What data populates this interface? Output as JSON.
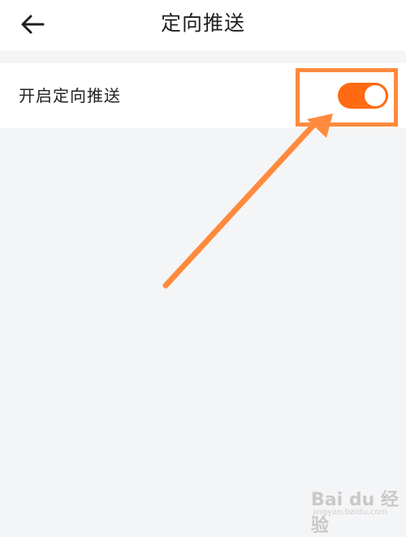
{
  "header": {
    "title": "定向推送",
    "back_icon": "arrow-left-icon"
  },
  "settings": [
    {
      "label": "开启定向推送",
      "toggle_on": true
    }
  ],
  "colors": {
    "accent": "#ff6a13",
    "annotation": "#ff8a3d",
    "background": "#f4f5f7"
  },
  "watermark": {
    "brand": "Bai du 经验",
    "url": "jingyan.baidu.com"
  }
}
